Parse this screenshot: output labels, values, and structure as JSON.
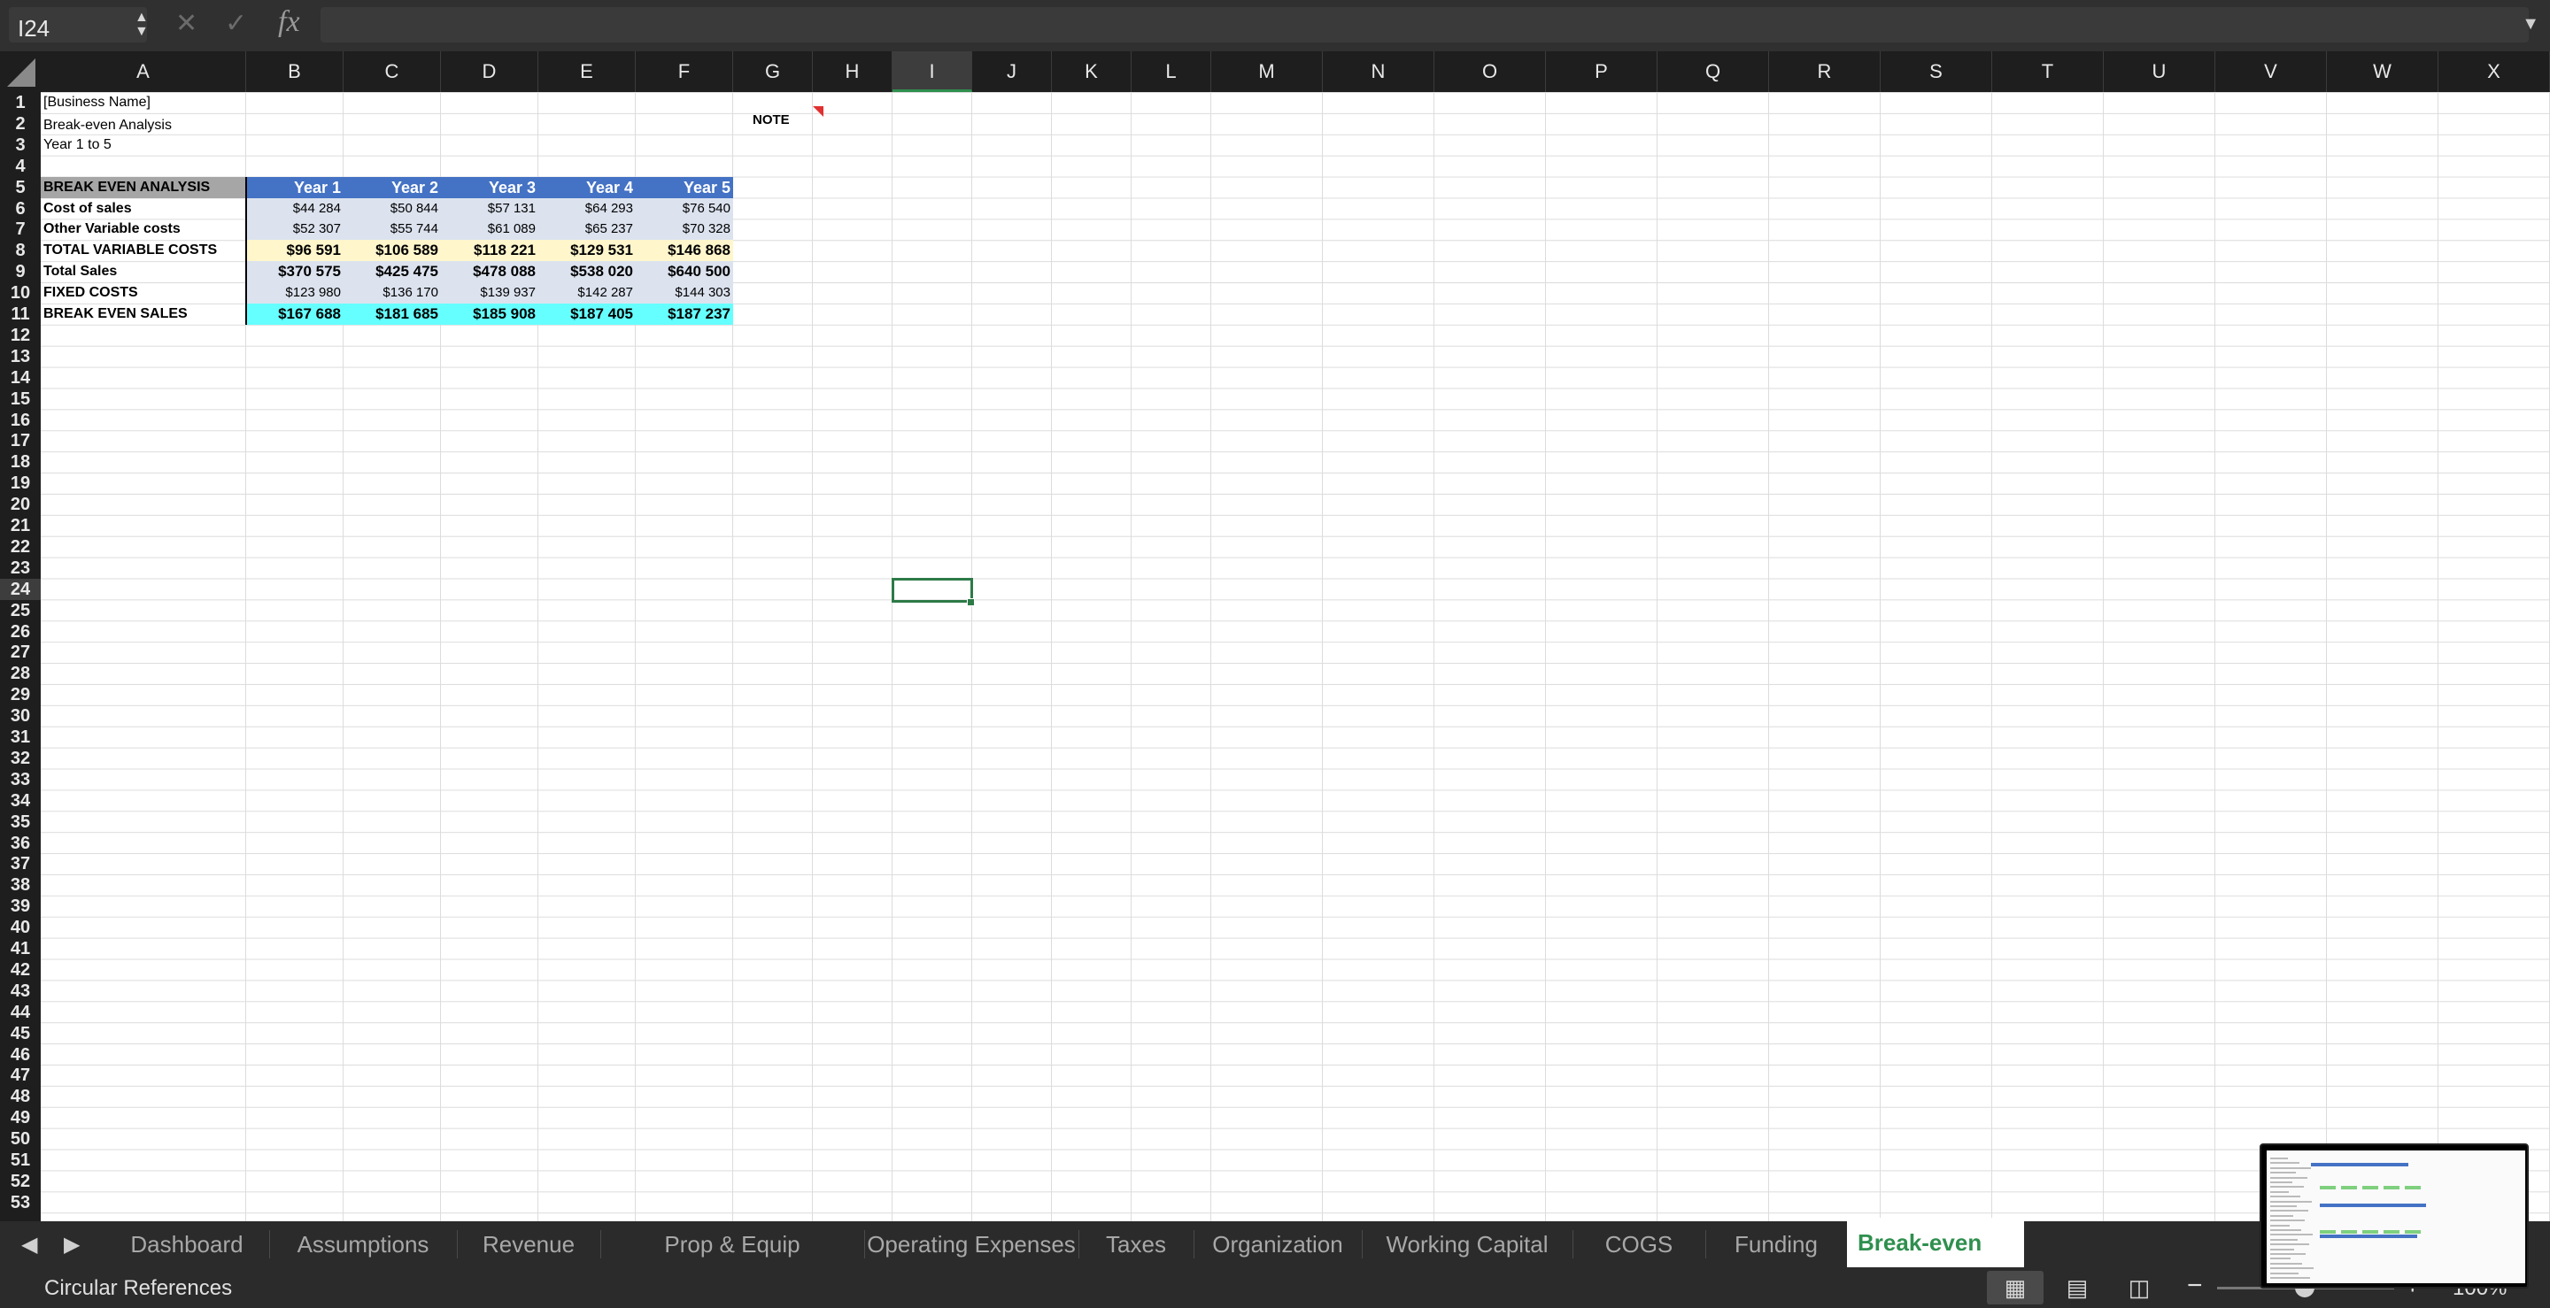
{
  "formula_bar": {
    "name_box": "I24",
    "formula": ""
  },
  "columns": [
    "A",
    "B",
    "C",
    "D",
    "E",
    "F",
    "G",
    "H",
    "I",
    "J",
    "K",
    "L",
    "M",
    "N",
    "O",
    "P",
    "Q",
    "R",
    "S",
    "T",
    "U",
    "V",
    "W",
    "X"
  ],
  "selected_column": "I",
  "selected_row": 24,
  "row_count": 53,
  "header_block": {
    "business_name": "[Business Name]",
    "title": "Break-even Analysis",
    "period": "Year 1 to 5"
  },
  "note_label": "NOTE",
  "table": {
    "header_label": "BREAK EVEN ANALYSIS",
    "years": [
      "Year 1",
      "Year 2",
      "Year 3",
      "Year 4",
      "Year 5"
    ],
    "rows": [
      {
        "label": "Cost of sales",
        "values": [
          "$44 284",
          "$50 844",
          "$57 131",
          "$64 293",
          "$76 540"
        ]
      },
      {
        "label": "Other Variable costs",
        "values": [
          "$52 307",
          "$55 744",
          "$61 089",
          "$65 237",
          "$70 328"
        ]
      },
      {
        "label": "TOTAL VARIABLE COSTS",
        "values": [
          "$96 591",
          "$106 589",
          "$118 221",
          "$129 531",
          "$146 868"
        ]
      },
      {
        "label": "Total Sales",
        "values": [
          "$370 575",
          "$425 475",
          "$478 088",
          "$538 020",
          "$640 500"
        ]
      },
      {
        "label": "FIXED COSTS",
        "values": [
          "$123 980",
          "$136 170",
          "$139 937",
          "$142 287",
          "$144 303"
        ]
      },
      {
        "label": "BREAK EVEN SALES",
        "values": [
          "$167 688",
          "$181 685",
          "$185 908",
          "$187 405",
          "$187 237"
        ]
      }
    ]
  },
  "sheet_tabs": [
    "Dashboard",
    "Assumptions",
    "Revenue",
    "Prop & Equip Depreciation",
    "Operating Expenses",
    "Taxes",
    "Organization",
    "Working Capital",
    "COGS",
    "Funding",
    "Break-even Ana"
  ],
  "active_tab_index": 10,
  "status": {
    "text": "Circular References",
    "zoom": "100%"
  },
  "icons": {
    "cancel": "x-icon",
    "confirm": "check-icon",
    "function": "fx-icon"
  },
  "colors": {
    "header_blue": "#4472c4",
    "accent_green": "#2f8f4e",
    "break_even_cyan": "#66ffff",
    "total_var_yellow": "#fff6cc"
  }
}
